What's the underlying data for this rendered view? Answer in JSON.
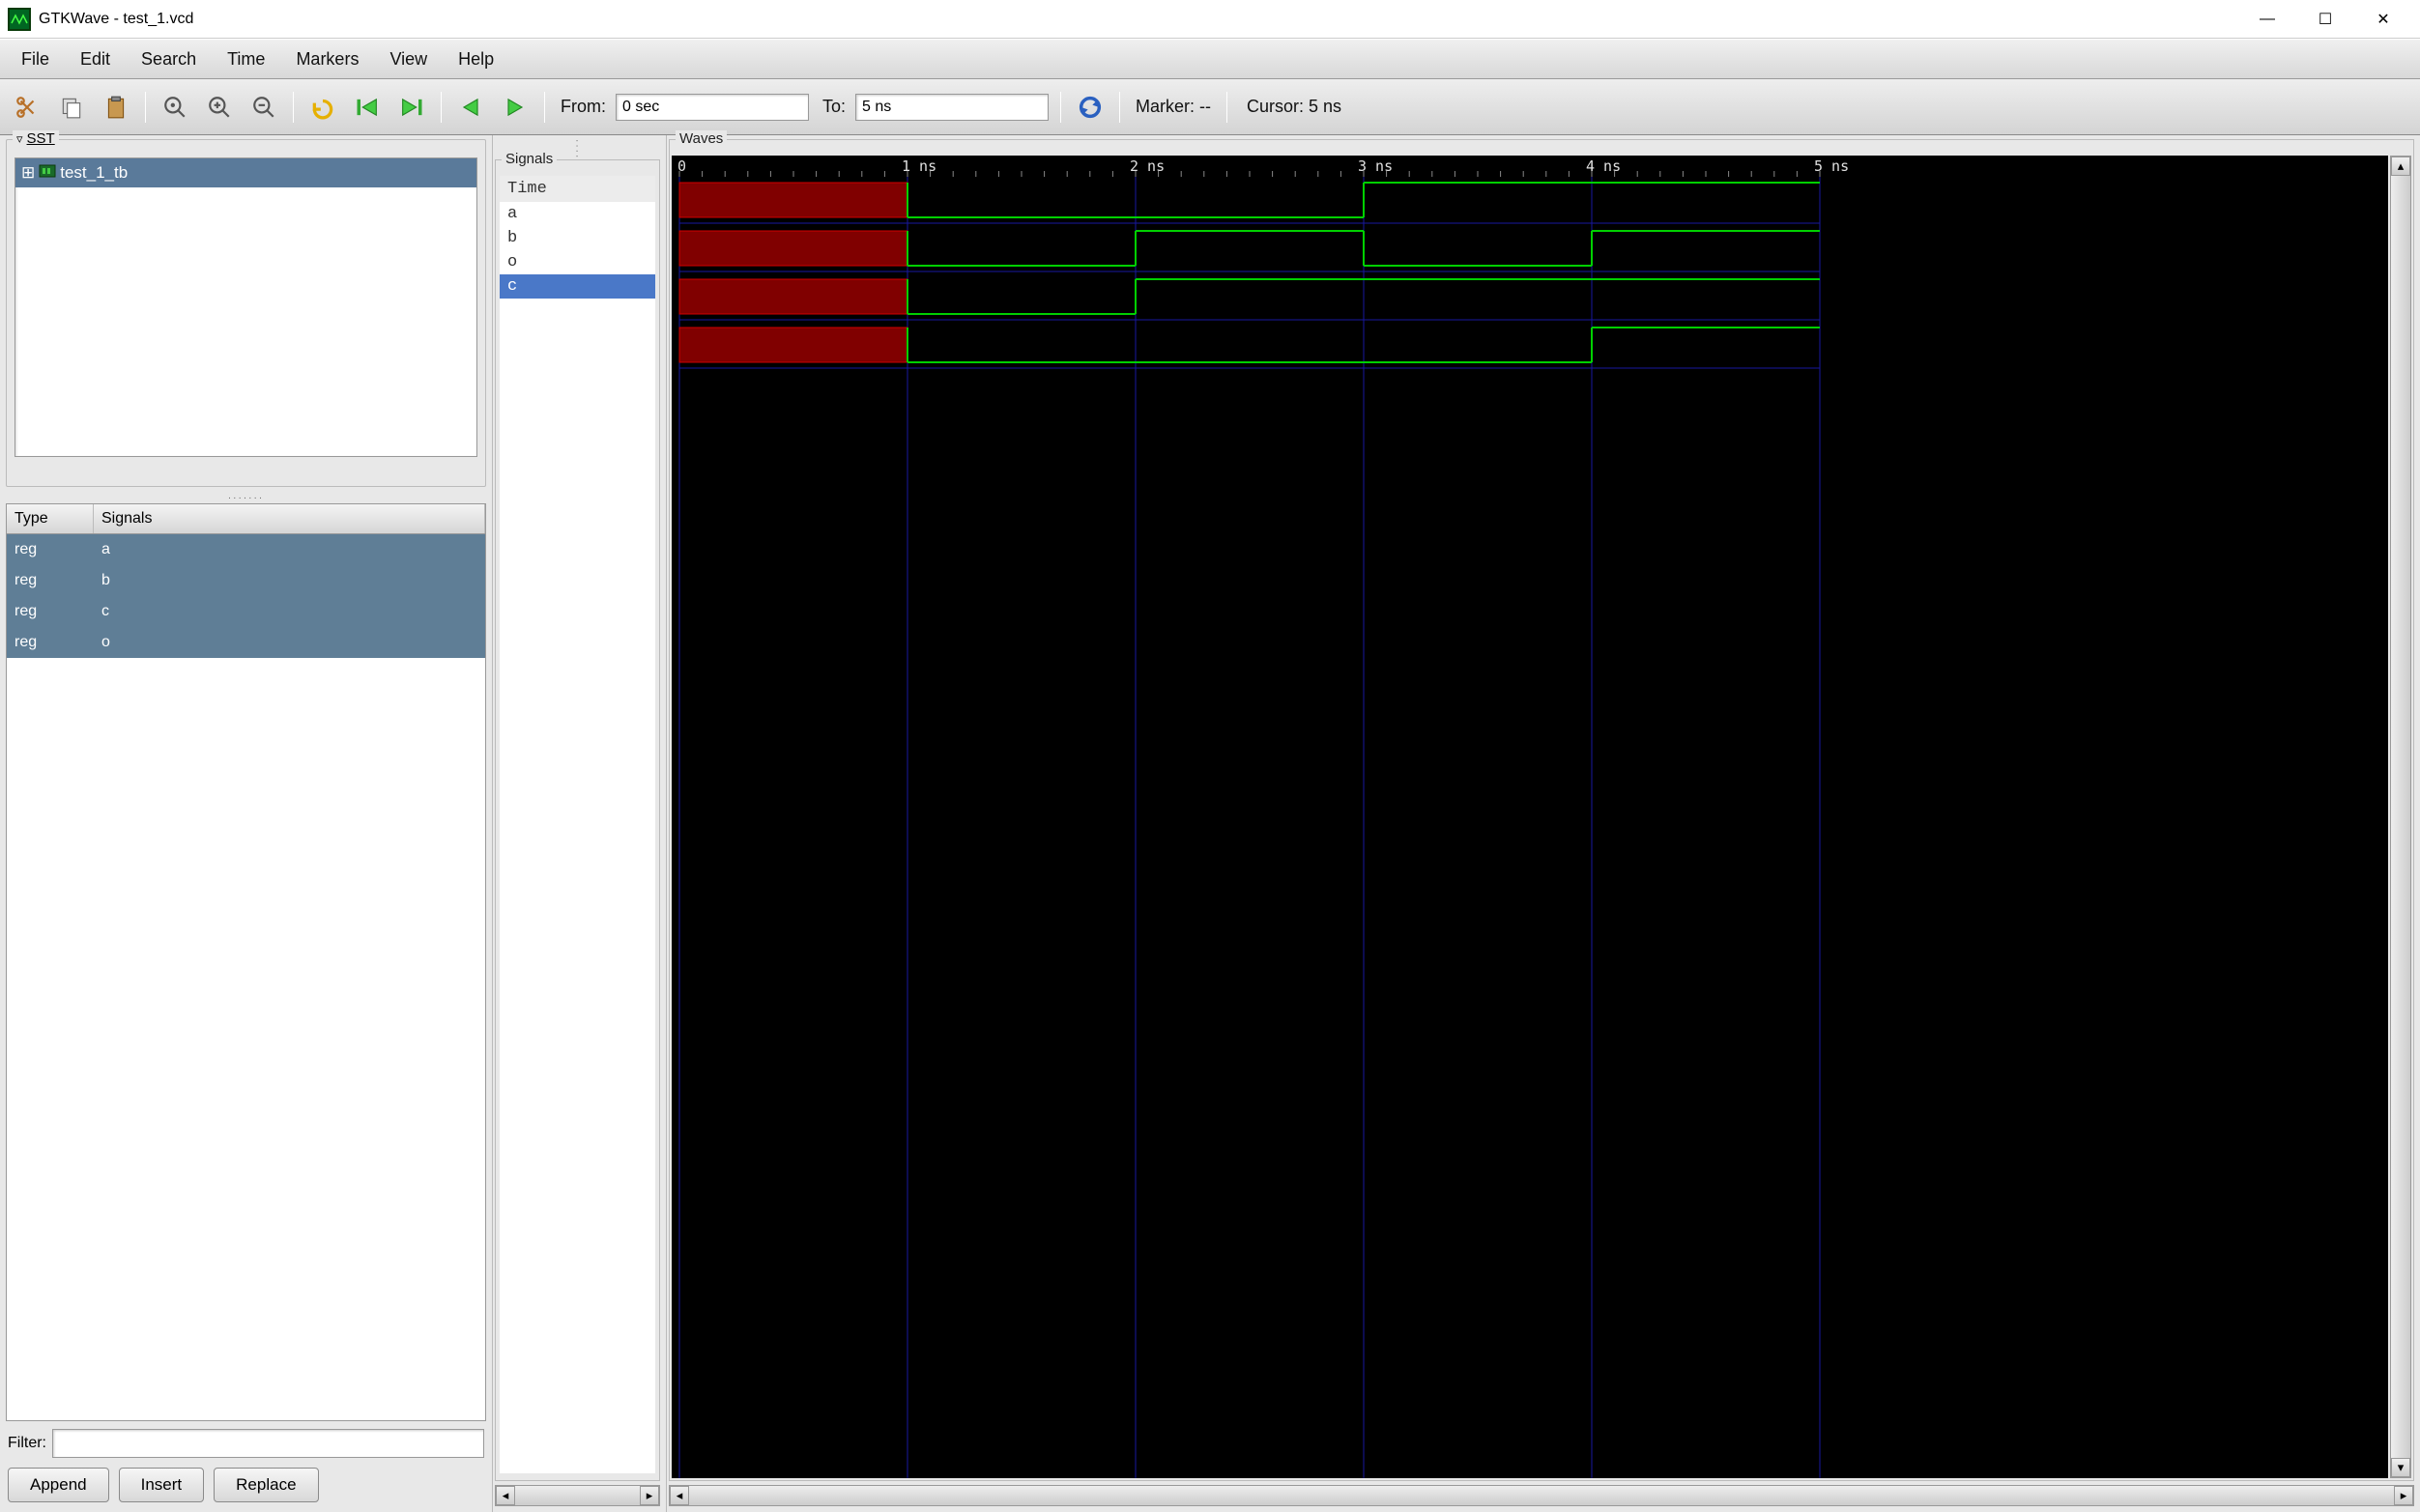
{
  "window": {
    "title": "GTKWave - test_1.vcd"
  },
  "menus": {
    "file": "File",
    "edit": "Edit",
    "search": "Search",
    "time": "Time",
    "markers": "Markers",
    "view": "View",
    "help": "Help"
  },
  "toolbar": {
    "from_label": "From:",
    "from_value": "0 sec",
    "to_label": "To:",
    "to_value": "5 ns",
    "marker_label": "Marker: --",
    "cursor_label": "Cursor: 5 ns"
  },
  "sst": {
    "label": "SST",
    "root": "test_1_tb"
  },
  "sig_table": {
    "head_type": "Type",
    "head_signals": "Signals",
    "rows": [
      {
        "type": "reg",
        "name": "a"
      },
      {
        "type": "reg",
        "name": "b"
      },
      {
        "type": "reg",
        "name": "c"
      },
      {
        "type": "reg",
        "name": "o"
      }
    ]
  },
  "filter": {
    "label": "Filter:",
    "value": ""
  },
  "buttons": {
    "append": "Append",
    "insert": "Insert",
    "replace": "Replace"
  },
  "signals_panel": {
    "label": "Signals",
    "time_head": "Time",
    "entries": [
      {
        "name": "a",
        "selected": false
      },
      {
        "name": "b",
        "selected": false
      },
      {
        "name": "o",
        "selected": false
      },
      {
        "name": "c",
        "selected": true
      }
    ]
  },
  "waves": {
    "label": "Waves",
    "ticks": [
      {
        "pos": 1,
        "label": "1 ns"
      },
      {
        "pos": 2,
        "label": "2 ns"
      },
      {
        "pos": 3,
        "label": "3 ns"
      },
      {
        "pos": 4,
        "label": "4 ns"
      },
      {
        "pos": 5,
        "label": "5 ns"
      }
    ],
    "x_range": [
      0,
      5
    ],
    "signals": [
      {
        "name": "a",
        "segments": [
          {
            "kind": "x",
            "from": 0,
            "to": 1
          },
          {
            "kind": "v",
            "level": 0,
            "from": 1,
            "to": 3
          },
          {
            "kind": "v",
            "level": 1,
            "from": 3,
            "to": 5
          }
        ]
      },
      {
        "name": "b",
        "segments": [
          {
            "kind": "x",
            "from": 0,
            "to": 1
          },
          {
            "kind": "v",
            "level": 0,
            "from": 1,
            "to": 2
          },
          {
            "kind": "v",
            "level": 1,
            "from": 2,
            "to": 3
          },
          {
            "kind": "v",
            "level": 0,
            "from": 3,
            "to": 4
          },
          {
            "kind": "v",
            "level": 1,
            "from": 4,
            "to": 5
          }
        ]
      },
      {
        "name": "o",
        "segments": [
          {
            "kind": "x",
            "from": 0,
            "to": 1
          },
          {
            "kind": "v",
            "level": 0,
            "from": 1,
            "to": 2
          },
          {
            "kind": "v",
            "level": 1,
            "from": 2,
            "to": 5
          }
        ]
      },
      {
        "name": "c",
        "segments": [
          {
            "kind": "x",
            "from": 0,
            "to": 1
          },
          {
            "kind": "v",
            "level": 0,
            "from": 1,
            "to": 4
          },
          {
            "kind": "v",
            "level": 1,
            "from": 4,
            "to": 5
          }
        ]
      }
    ],
    "row_selected": 3
  }
}
